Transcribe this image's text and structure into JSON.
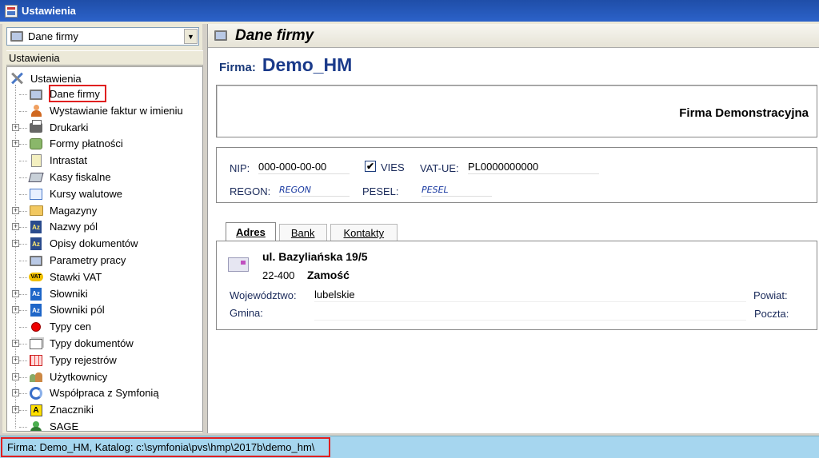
{
  "window": {
    "title": "Ustawienia"
  },
  "left": {
    "combo_value": "Dane firmy",
    "tree_header": "Ustawienia",
    "root_label": "Ustawienia",
    "items": [
      {
        "label": "Dane firmy",
        "icon": "monitor-icon",
        "expandable": false,
        "selected": true
      },
      {
        "label": "Wystawianie faktur w imieniu",
        "icon": "person-icon",
        "expandable": false
      },
      {
        "label": "Drukarki",
        "icon": "printer-icon",
        "expandable": true
      },
      {
        "label": "Formy płatności",
        "icon": "payment-icon",
        "expandable": true
      },
      {
        "label": "Intrastat",
        "icon": "intrastat-icon",
        "expandable": false
      },
      {
        "label": "Kasy fiskalne",
        "icon": "cash-register-icon",
        "expandable": false
      },
      {
        "label": "Kursy walutowe",
        "icon": "chart-icon",
        "expandable": false
      },
      {
        "label": "Magazyny",
        "icon": "folder-icon",
        "expandable": true
      },
      {
        "label": "Nazwy pól",
        "icon": "az-icon",
        "expandable": true
      },
      {
        "label": "Opisy dokumentów",
        "icon": "az-icon",
        "expandable": true
      },
      {
        "label": "Parametry pracy",
        "icon": "monitor-icon",
        "expandable": false
      },
      {
        "label": "Stawki VAT",
        "icon": "vat-icon",
        "expandable": false
      },
      {
        "label": "Słowniki",
        "icon": "az-blue-icon",
        "expandable": true
      },
      {
        "label": "Słowniki pól",
        "icon": "az-blue-icon",
        "expandable": true
      },
      {
        "label": "Typy cen",
        "icon": "red-ball-icon",
        "expandable": false
      },
      {
        "label": "Typy dokumentów",
        "icon": "documents-icon",
        "expandable": true
      },
      {
        "label": "Typy rejestrów",
        "icon": "grid-icon",
        "expandable": true
      },
      {
        "label": "Użytkownicy",
        "icon": "users-icon",
        "expandable": true
      },
      {
        "label": "Współpraca z Symfonią",
        "icon": "sync-icon",
        "expandable": true
      },
      {
        "label": "Znaczniki",
        "icon": "marker-icon",
        "expandable": true
      },
      {
        "label": "SAGE",
        "icon": "sage-icon",
        "expandable": false
      }
    ]
  },
  "right": {
    "page_title": "Dane firmy",
    "firma_label": "Firma:",
    "firma_value": "Demo_HM",
    "company_full_name": "Firma Demonstracyjna",
    "nip_label": "NIP:",
    "nip_value": "000-000-00-00",
    "vies_label": "VIES",
    "vies_checked": "✔",
    "vatue_label": "VAT-UE:",
    "vatue_value": "PL0000000000",
    "regon_label": "REGON:",
    "regon_value": "REGON",
    "pesel_label": "PESEL:",
    "pesel_value": "PESEL",
    "tabs": [
      "Adres",
      "Bank",
      "Kontakty"
    ],
    "address": {
      "street": "ul. Bazyliańska 19/5",
      "postal_code": "22-400",
      "city": "Zamość",
      "wojewodztwo_label": "Województwo:",
      "wojewodztwo_value": "lubelskie",
      "gmina_label": "Gmina:",
      "powiat_label": "Powiat:",
      "poczta_label": "Poczta:"
    }
  },
  "status": {
    "text": "Firma: Demo_HM, Katalog: c:\\symfonia\\pvs\\hmp\\2017b\\demo_hm\\"
  }
}
